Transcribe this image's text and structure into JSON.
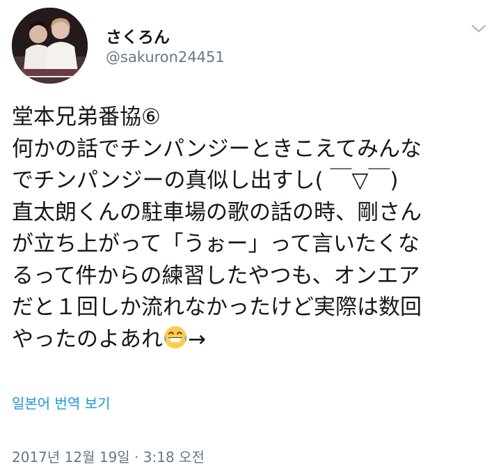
{
  "user": {
    "display_name": "さくろん",
    "handle": "@sakuron24451"
  },
  "tweet": {
    "lines": [
      "堂本兄弟番協⑥",
      "何かの話でチンパンジーときこえてみんな",
      "でチンパンジーの真似し出すし( ￣▽￣)",
      "直太朗くんの駐車場の歌の話の時、剛さん",
      "が立ち上がって「うぉー」って言いたくな",
      "るって件からの練習したやつも、オンエア",
      "だと１回しか流れなかったけど実際は数回",
      "やったのよあれ"
    ],
    "last_line_suffix": "→",
    "emoji_icon": "grinning-sweat-face-icon"
  },
  "translate_label": "일본어 번역 보기",
  "timestamp": "2017년 12월 19일 · 3:18 오전",
  "colors": {
    "link": "#1b95e0",
    "secondary": "#657786",
    "text": "#14171a"
  }
}
